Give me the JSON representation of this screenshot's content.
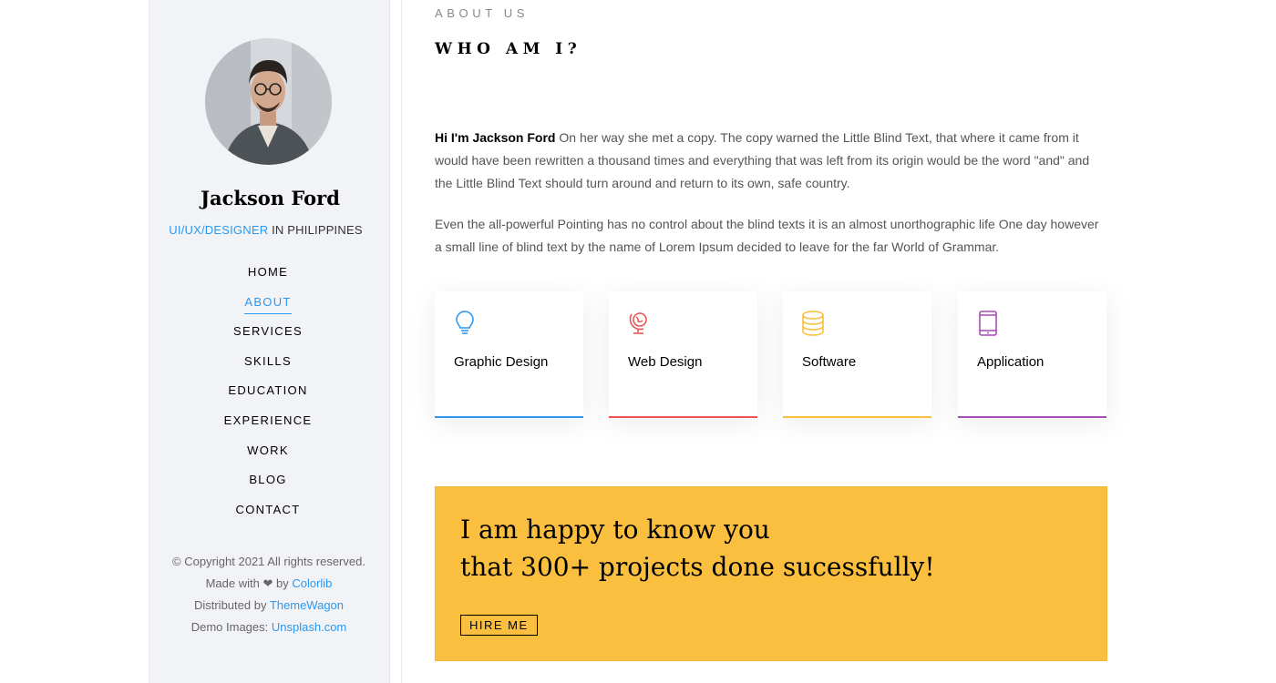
{
  "profile": {
    "name": "Jackson Ford",
    "role_accent": "UI/UX/DESIGNER",
    "role_rest": "IN PHILIPPINES"
  },
  "nav": {
    "items": [
      {
        "label": "HOME"
      },
      {
        "label": "ABOUT",
        "active": true
      },
      {
        "label": "SERVICES"
      },
      {
        "label": "SKILLS"
      },
      {
        "label": "EDUCATION"
      },
      {
        "label": "EXPERIENCE"
      },
      {
        "label": "WORK"
      },
      {
        "label": "BLOG"
      },
      {
        "label": "CONTACT"
      }
    ]
  },
  "footer": {
    "copyright": "© Copyright 2021 All rights reserved.",
    "made_with_prefix": "Made with",
    "heart": "❤",
    "made_with_by": "by",
    "made_with_link": "Colorlib",
    "distributed_prefix": "Distributed by",
    "distributed_link": "ThemeWagon",
    "demo_prefix": "Demo Images:",
    "demo_link": "Unsplash.com"
  },
  "about": {
    "eyebrow": "ABOUT US",
    "heading": "WHO AM I?",
    "para1_bold": "Hi I'm Jackson Ford",
    "para1_text": " On her way she met a copy. The copy warned the Little Blind Text, that where it came from it would have been rewritten a thousand times and everything that was left from its origin would be the word \"and\" and the Little Blind Text should turn around and return to its own, safe country.",
    "para2_text": "Even the all-powerful Pointing has no control about the blind texts it is an almost unorthographic life One day however a small line of blind text by the name of Lorem Ipsum decided to leave for the far World of Grammar."
  },
  "services": [
    {
      "label": "Graphic Design",
      "icon": "bulb-icon",
      "color": "#2c98f0"
    },
    {
      "label": "Web Design",
      "icon": "globe-icon",
      "color": "#ec5453"
    },
    {
      "label": "Software",
      "icon": "database-icon",
      "color": "#f9bf3f"
    },
    {
      "label": "Application",
      "icon": "tablet-icon",
      "color": "#a84cb8"
    }
  ],
  "cta": {
    "line1": "I am happy to know you",
    "line2": "that 300+ projects done sucessfully!",
    "button": "HIRE ME",
    "background": "#fabf3f"
  }
}
